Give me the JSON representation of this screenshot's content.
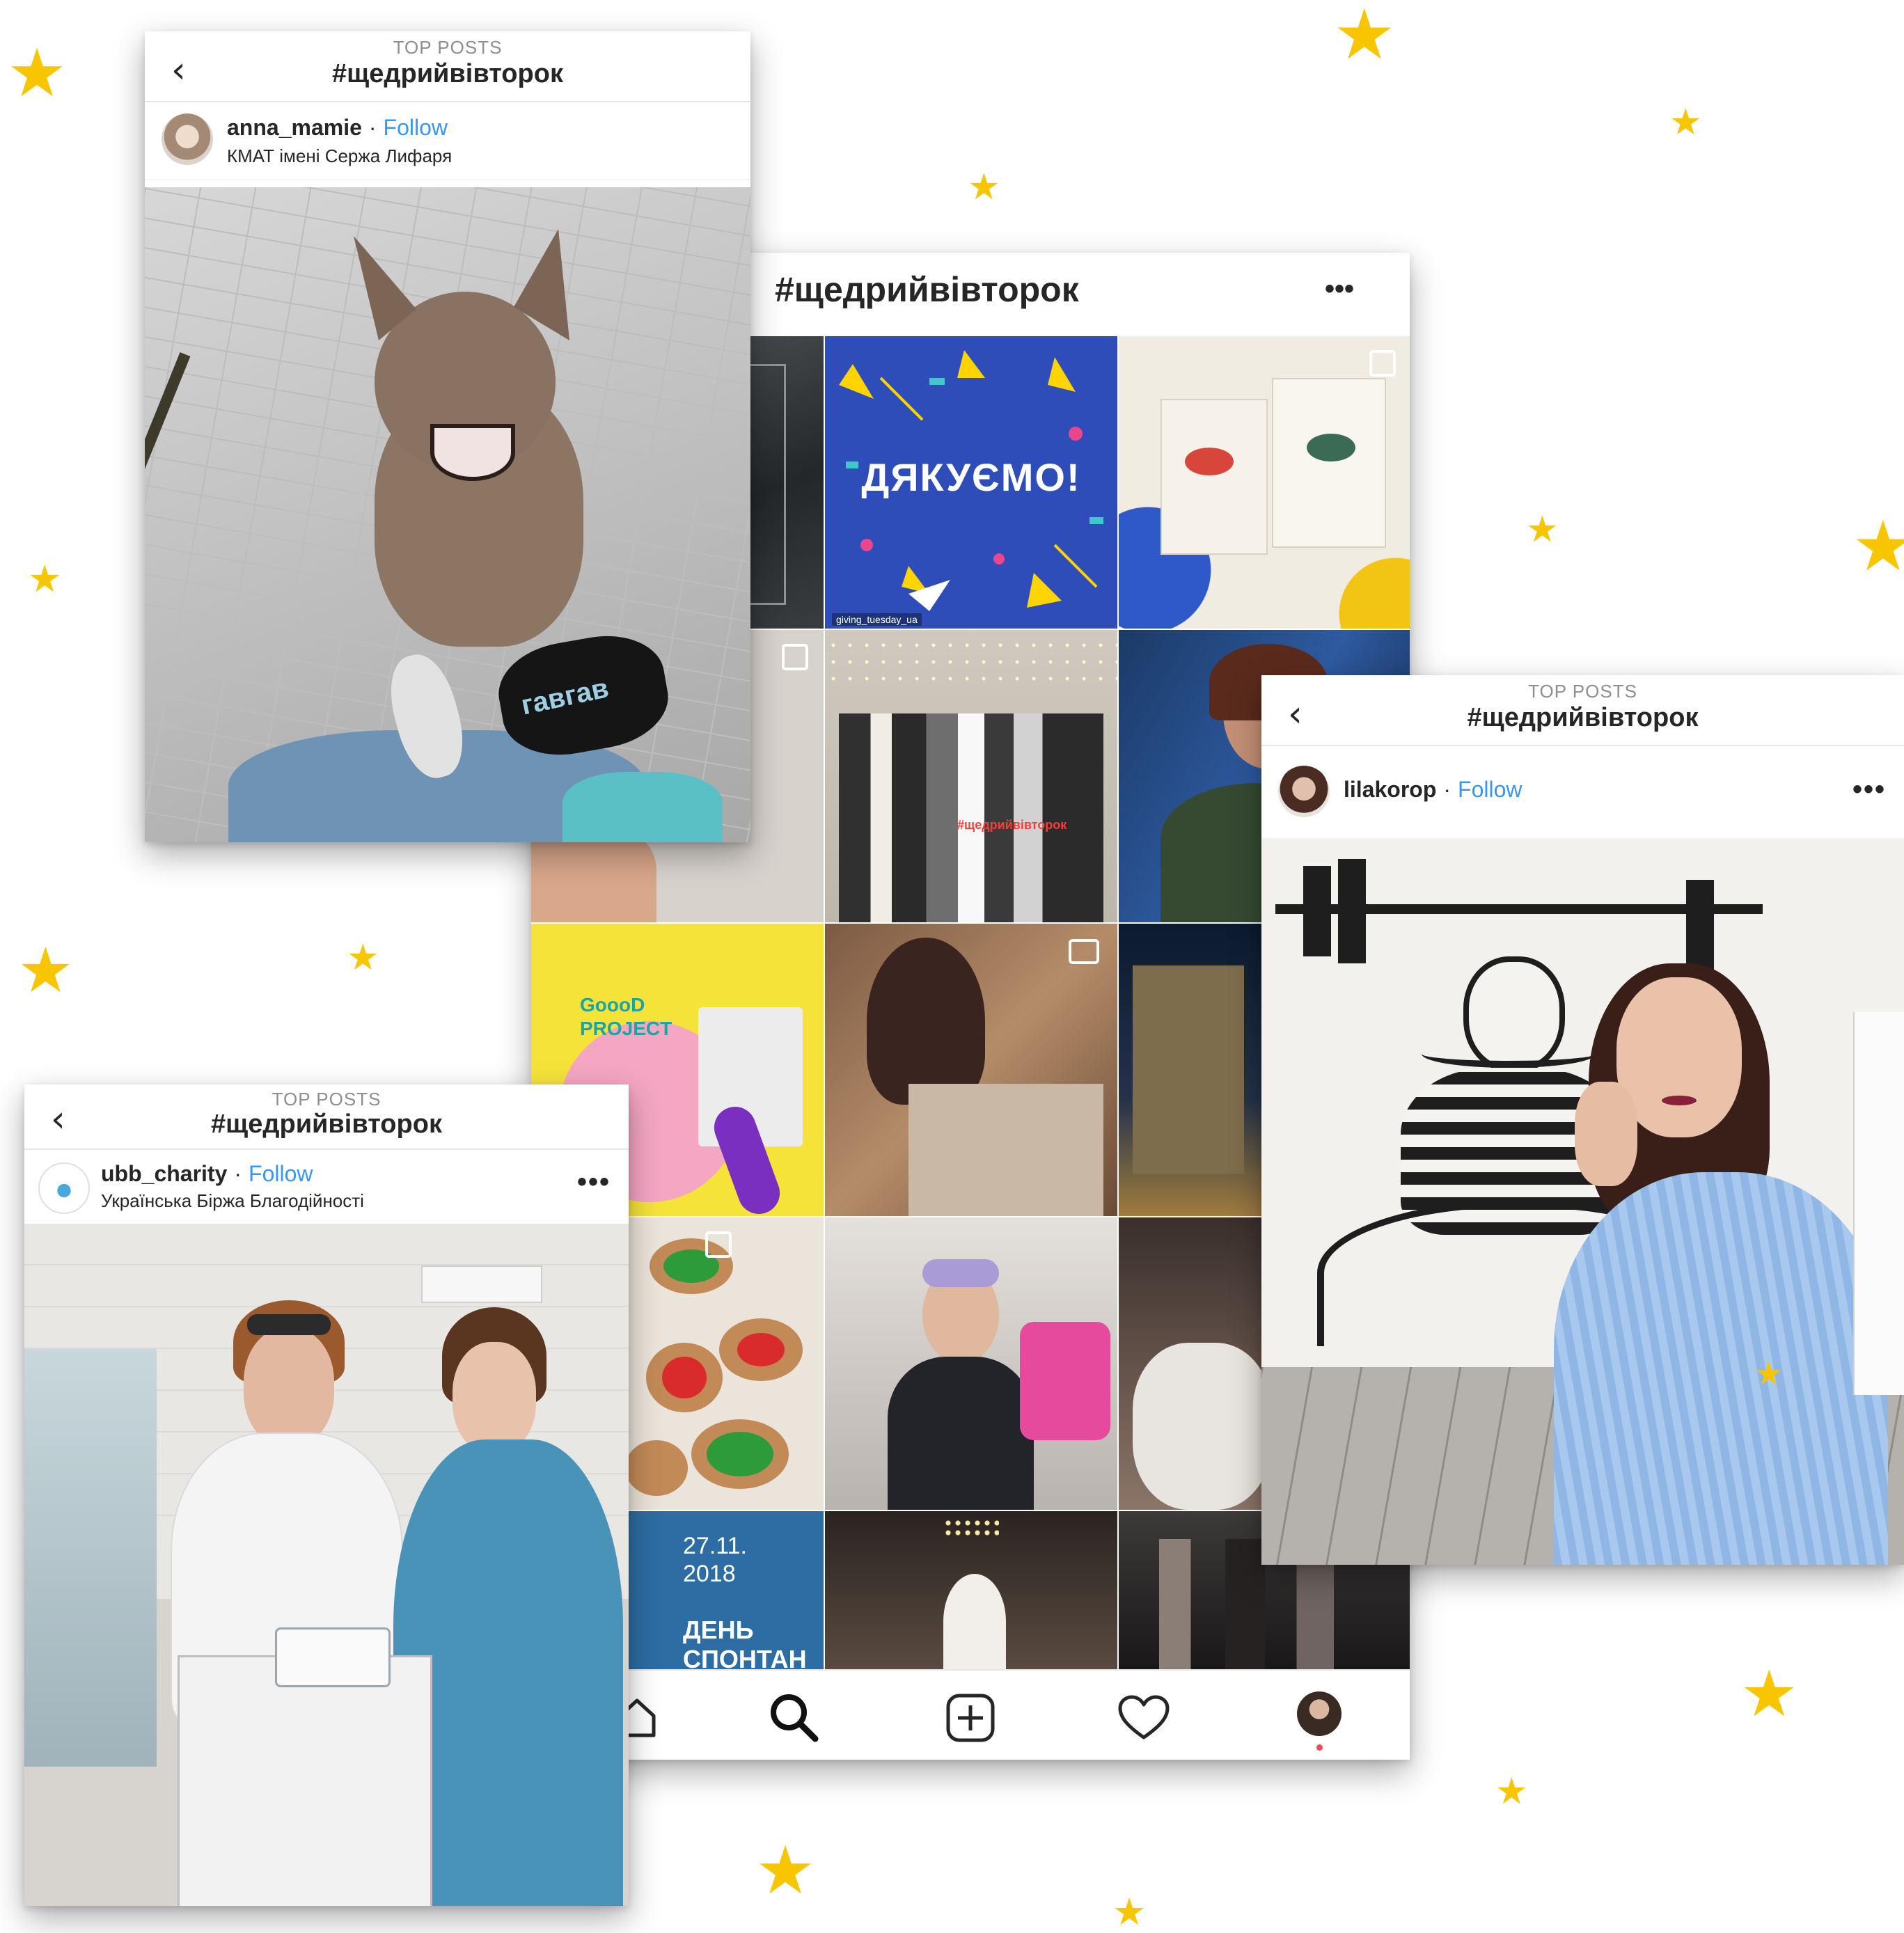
{
  "colors": {
    "star": "#f7c600",
    "follow_link": "#3897f0",
    "notification_dot": "#ed4956"
  },
  "card_anna": {
    "header_sub": "TOP POSTS",
    "header_title": "#щедрийвівторок",
    "back_icon": "chevron-left",
    "username": "anna_mamie",
    "separator": "·",
    "follow": "Follow",
    "location": "КМАТ імені Сержа Лифаря",
    "muzzle_text": "гавгав"
  },
  "card_grid": {
    "title": "#щедрийвівторок",
    "more": "•••",
    "tiles": {
      "thanks_text": "ДЯКУЄМО!",
      "repost_user": "giving_tuesday_ua",
      "banner_text": "#щедрийвівторок",
      "good_project": "GoooD PROJECT",
      "date_text": "27.11. 2018",
      "day_text": "ДЕНЬ СПОНТАН"
    },
    "nav": [
      "home-icon",
      "search-icon",
      "add-icon",
      "heart-icon",
      "profile-avatar"
    ]
  },
  "card_lila": {
    "header_sub": "TOP POSTS",
    "header_title": "#щедрийвівторок",
    "username": "lilakorop",
    "separator": "·",
    "follow": "Follow",
    "more": "•••"
  },
  "card_ubb": {
    "header_sub": "TOP POSTS",
    "header_title": "#щедрийвівторок",
    "username": "ubb_charity",
    "separator": "·",
    "follow": "Follow",
    "location": "Українська Біржа Благодійності",
    "more": "•••"
  }
}
